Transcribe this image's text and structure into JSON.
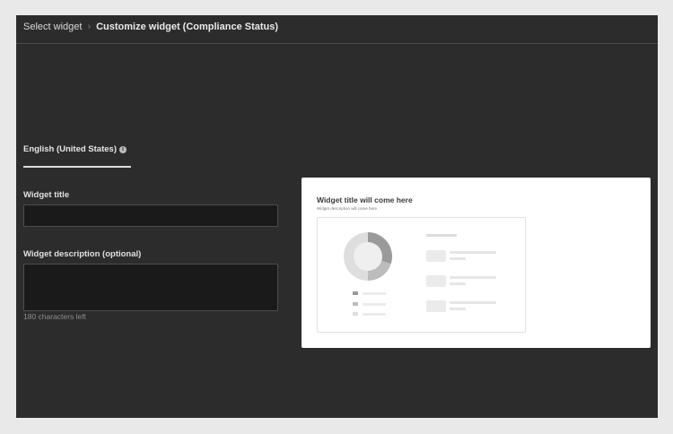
{
  "breadcrumb": {
    "parent": "Select widget",
    "separator": "›",
    "current": "Customize widget (Compliance Status)"
  },
  "language_tab": {
    "label": "English (United States)",
    "info_icon": "info-icon"
  },
  "form": {
    "title_label": "Widget title",
    "title_value": "",
    "description_label": "Widget description (optional)",
    "description_value": "",
    "chars_left": "180 characters left"
  },
  "preview": {
    "title": "Widget title will come here",
    "description": "Widget description will come here",
    "donut_shares": [
      0.3,
      0.2,
      0.5
    ],
    "legend_colors": [
      "#9a9a9a",
      "#bcbcbc",
      "#dedede"
    ]
  },
  "colors": {
    "panel_bg": "#2c2c2c",
    "input_bg": "#1a1a1a",
    "preview_bg": "#ffffff"
  }
}
